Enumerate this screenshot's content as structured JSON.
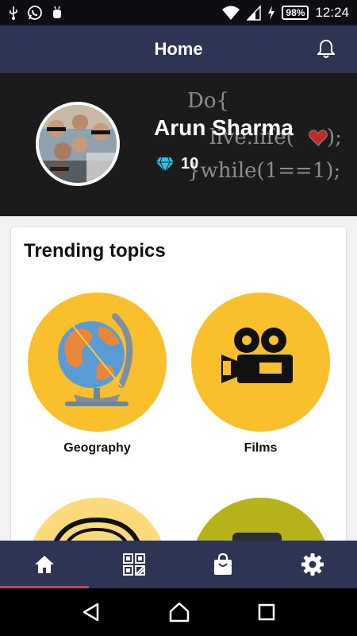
{
  "status_bar": {
    "battery": "98%",
    "time": "12:24",
    "icons": [
      "usb-icon",
      "whatsapp-icon",
      "android-debug-icon",
      "wifi-icon",
      "signal-icon",
      "charging-icon"
    ]
  },
  "app_bar": {
    "title": "Home",
    "notification_icon": "bell-icon"
  },
  "profile": {
    "name": "Arun Sharma",
    "gems": "10",
    "gem_icon": "diamond-icon",
    "background_text": [
      "Do{",
      "live.life(",
      ");",
      "}while(1==1);"
    ]
  },
  "trending": {
    "title": "Trending topics",
    "topics": [
      {
        "label": "Geography",
        "icon": "globe-icon",
        "color": "#f9bf2c"
      },
      {
        "label": "Films",
        "icon": "movie-camera-icon",
        "color": "#f9bf2c"
      },
      {
        "label": "",
        "icon": "headphones-icon",
        "color": "#fcd97a"
      },
      {
        "label": "",
        "icon": "tv-icon",
        "color": "#b6b21c"
      }
    ]
  },
  "bottom_nav": {
    "items": [
      "home-icon",
      "qr-code-icon",
      "shopping-bag-icon",
      "settings-icon"
    ],
    "active": "home-icon",
    "active_color": "#e53935"
  },
  "system_nav": [
    "back-icon",
    "home-circle-icon",
    "recents-icon"
  ],
  "colors": {
    "primary": "#2d3454",
    "accent_yellow": "#f9bf2c",
    "gem": "#29c6e8"
  }
}
